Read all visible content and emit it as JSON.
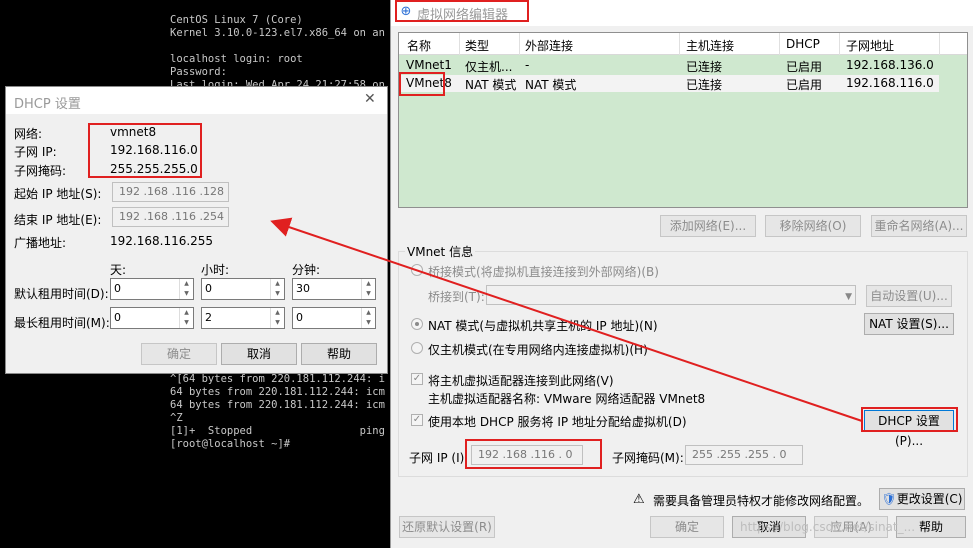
{
  "terminal": {
    "lines_top": [
      "CentOS Linux 7 (Core)",
      "Kernel 3.10.0-123.el7.x86_64 on an",
      "",
      "localhost login: root",
      "Password:",
      "Last login: Wed Apr 24 21:27:58 on"
    ],
    "lines_bottom": [
      "^[64 bytes from 220.181.112.244: i",
      "64 bytes from 220.181.112.244: icm",
      "64 bytes from 220.181.112.244: icm",
      "^Z",
      "[1]+  Stopped                 ping",
      "[root@localhost ~]#"
    ]
  },
  "vne": {
    "title": "虚拟网络编辑器",
    "columns": [
      "名称",
      "类型",
      "外部连接",
      "主机连接",
      "DHCP",
      "子网地址"
    ],
    "rows": [
      {
        "name": "VMnet1",
        "type": "仅主机...",
        "external": "-",
        "host": "已连接",
        "dhcp": "已启用",
        "subnet": "192.168.136.0"
      },
      {
        "name": "VMnet8",
        "type": "NAT 模式",
        "external": "NAT 模式",
        "host": "已连接",
        "dhcp": "已启用",
        "subnet": "192.168.116.0"
      }
    ],
    "buttons": {
      "add": "添加网络(E)...",
      "remove": "移除网络(O)",
      "rename": "重命名网络(A)..."
    },
    "info_title": "VMnet 信息",
    "bridge_label": "桥接模式(将虚拟机直接连接到外部网络)(B)",
    "bridge_to_label": "桥接到(T):",
    "auto_settings": "自动设置(U)...",
    "nat_label": "NAT 模式(与虚拟机共享主机的 IP 地址)(N)",
    "nat_settings": "NAT 设置(S)...",
    "hostonly_label": "仅主机模式(在专用网络内连接虚拟机)(H)",
    "connect_adapter": "将主机虚拟适配器连接到此网络(V)",
    "adapter_name": "主机虚拟适配器名称: VMware 网络适配器 VMnet8",
    "use_dhcp": "使用本地 DHCP 服务将 IP 地址分配给虚拟机(D)",
    "dhcp_settings": "DHCP 设置(P)...",
    "subnet_ip_label": "子网 IP (I):",
    "subnet_ip": "192 .168 .116 .  0",
    "subnet_mask_label": "子网掩码(M):",
    "subnet_mask": "255 .255 .255 .  0",
    "admin_notice": "需要具备管理员特权才能修改网络配置。",
    "change_settings": "更改设置(C)",
    "restore": "还原默认设置(R)",
    "ok": "确定",
    "cancel": "取消",
    "apply": "应用(A)",
    "help": "帮助"
  },
  "dhcp": {
    "title": "DHCP 设置",
    "network_label": "网络:",
    "network": "vmnet8",
    "subnet_ip_label": "子网 IP:",
    "subnet_ip": "192.168.116.0",
    "subnet_mask_label": "子网掩码:",
    "subnet_mask": "255.255.255.0",
    "start_ip_label": "起始 IP 地址(S):",
    "start_ip": "192 .168 .116 .128",
    "end_ip_label": "结束 IP 地址(E):",
    "end_ip": "192 .168 .116 .254",
    "broadcast_label": "广播地址:",
    "broadcast": "192.168.116.255",
    "days": "天:",
    "hours": "小时:",
    "minutes": "分钟:",
    "default_lease_label": "默认租用时间(D):",
    "default_lease": {
      "days": "0",
      "hours": "0",
      "minutes": "30"
    },
    "max_lease_label": "最长租用时间(M):",
    "max_lease": {
      "days": "0",
      "hours": "2",
      "minutes": "0"
    },
    "ok": "确定",
    "cancel": "取消",
    "help": "帮助"
  },
  "watermark": "https://blog.csdn.net/sinat_...",
  "colors": {
    "highlight": "#e02020",
    "table_bg": "#cfe8cf",
    "focus": "#0078d7"
  }
}
